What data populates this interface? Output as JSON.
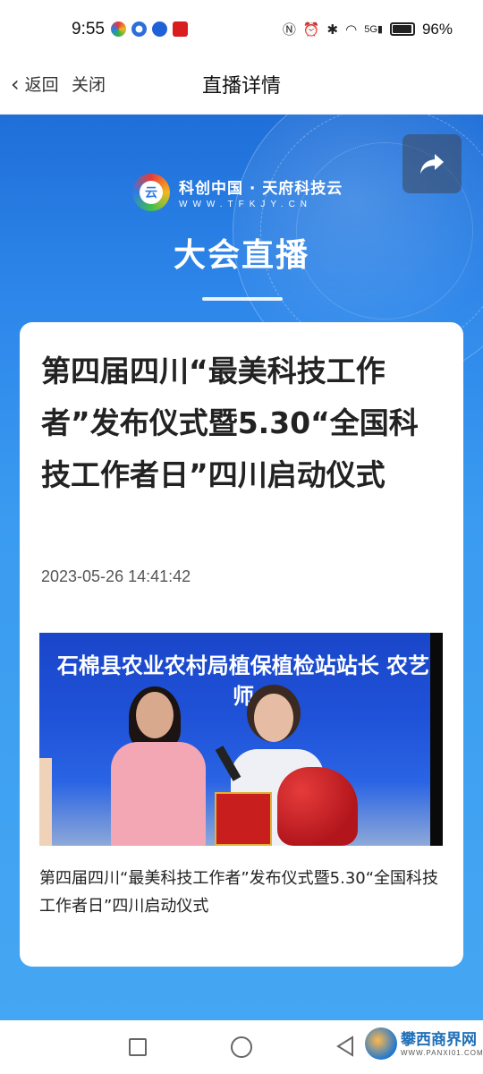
{
  "status_bar": {
    "time": "9:55",
    "network": "5G",
    "battery": "96%"
  },
  "nav": {
    "back_label": "返回",
    "close_label": "关闭",
    "title": "直播详情"
  },
  "banner": {
    "logo_text": "科创中国 · 天府科技云",
    "logo_url": "WWW.TFKJY.CN",
    "title": "大会直播"
  },
  "article": {
    "title": "第四届四川“最美科技工作者”发布仪式暨5.30“全国科技工作者日”四川启动仪式",
    "timestamp": "2023-05-26 14:41:42",
    "video": {
      "caption": "石棉县农业农村局植保植检站站长 农艺师"
    },
    "video_description": "第四届四川“最美科技工作者”发布仪式暨5.30“全国科技工作者日”四川启动仪式"
  },
  "watermark": {
    "name": "攀西商界网",
    "url": "WWW.PANXI01.COM"
  },
  "colors": {
    "banner_blue": "#2d86ea",
    "card_bg": "#ffffff"
  }
}
